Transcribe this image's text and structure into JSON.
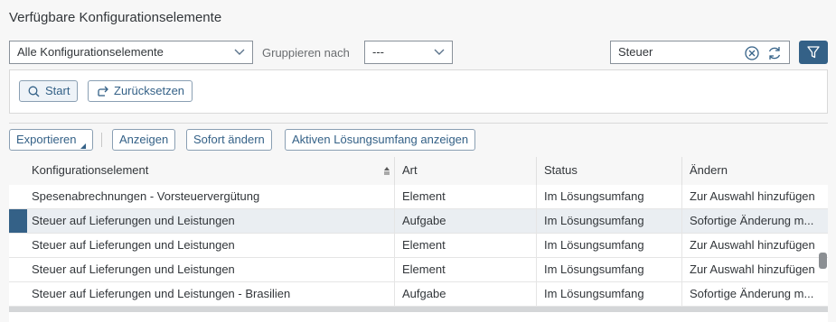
{
  "title": "Verfügbare Konfigurationselemente",
  "filter": {
    "scope_value": "Alle Konfigurationselemente",
    "group_label": "Gruppieren nach",
    "group_value": "---",
    "search_value": "Steuer"
  },
  "filterbar": {
    "start_label": "Start",
    "reset_label": "Zurücksetzen"
  },
  "toolbar": {
    "export_label": "Exportieren",
    "show_label": "Anzeigen",
    "change_label": "Sofort ändern",
    "scope_label": "Aktiven Lösungsumfang anzeigen"
  },
  "table": {
    "columns": [
      "Konfigurationselement",
      "Art",
      "Status",
      "Ändern"
    ],
    "rows": [
      [
        "Spesenabrechnungen - Vorsteuervergütung",
        "Element",
        "Im Lösungsumfang",
        "Zur Auswahl hinzufügen"
      ],
      [
        "Steuer auf Lieferungen und Leistungen",
        "Aufgabe",
        "Im Lösungsumfang",
        "Sofortige Änderung m..."
      ],
      [
        "Steuer auf Lieferungen und Leistungen",
        "Element",
        "Im Lösungsumfang",
        "Zur Auswahl hinzufügen"
      ],
      [
        "Steuer auf Lieferungen und Leistungen",
        "Element",
        "Im Lösungsumfang",
        "Zur Auswahl hinzufügen"
      ],
      [
        "Steuer auf Lieferungen und Leistungen - Brasilien",
        "Aufgabe",
        "Im Lösungsumfang",
        "Sofortige Änderung m..."
      ]
    ],
    "selected_row": 1
  },
  "icons": {
    "accent": "#346187"
  }
}
